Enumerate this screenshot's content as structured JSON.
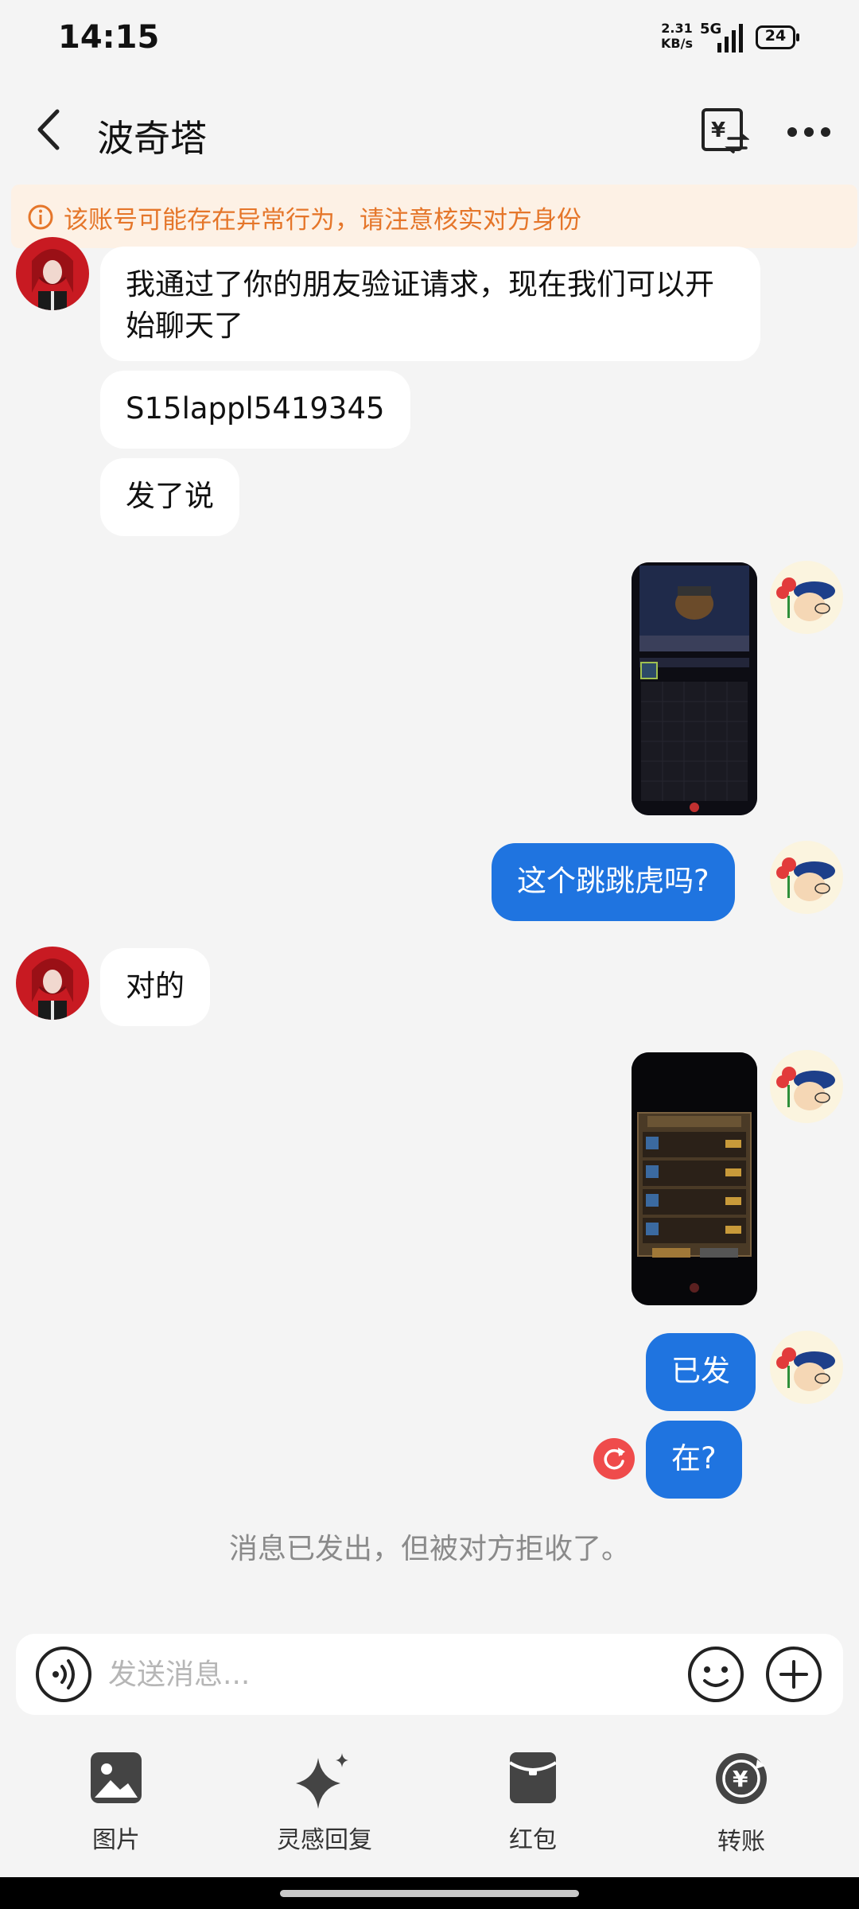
{
  "status_bar": {
    "time": "14:15",
    "net_speed_value": "2.31",
    "net_speed_unit": "KB/s",
    "network": "5G",
    "battery": "24"
  },
  "header": {
    "title": "波奇塔",
    "back_icon": "chevron-left-icon",
    "translate_icon": "translate-icon",
    "more_icon": "more-dots-icon"
  },
  "warning": {
    "text": "该账号可能存在异常行为，请注意核实对方身份"
  },
  "messages": [
    {
      "from": "contact",
      "type": "text",
      "text": "我通过了你的朋友验证请求，现在我们可以开始聊天了"
    },
    {
      "from": "contact",
      "type": "text",
      "text": "S15lappl5419345"
    },
    {
      "from": "contact",
      "type": "text",
      "text": "发了说"
    },
    {
      "from": "me",
      "type": "image"
    },
    {
      "from": "me",
      "type": "text",
      "text": "这个跳跳虎吗?"
    },
    {
      "from": "contact",
      "type": "text",
      "text": "对的"
    },
    {
      "from": "me",
      "type": "image"
    },
    {
      "from": "me",
      "type": "text",
      "text": "已发"
    },
    {
      "from": "me",
      "type": "text",
      "text": "在?",
      "failed": true
    }
  ],
  "system_notice": "消息已发出，但被对方拒收了。",
  "input": {
    "placeholder": "发送消息..."
  },
  "toolbar": {
    "items": [
      {
        "label": "图片",
        "icon": "image-icon"
      },
      {
        "label": "灵感回复",
        "icon": "sparkle-icon"
      },
      {
        "label": "红包",
        "icon": "red-packet-icon"
      },
      {
        "label": "转账",
        "icon": "transfer-icon"
      }
    ]
  },
  "colors": {
    "outgoing_bubble": "#1f74e0",
    "incoming_bubble": "#ffffff",
    "warning_text": "#e5762a",
    "warning_bg": "#fdf1e5",
    "failed_icon": "#ef4b4b"
  }
}
